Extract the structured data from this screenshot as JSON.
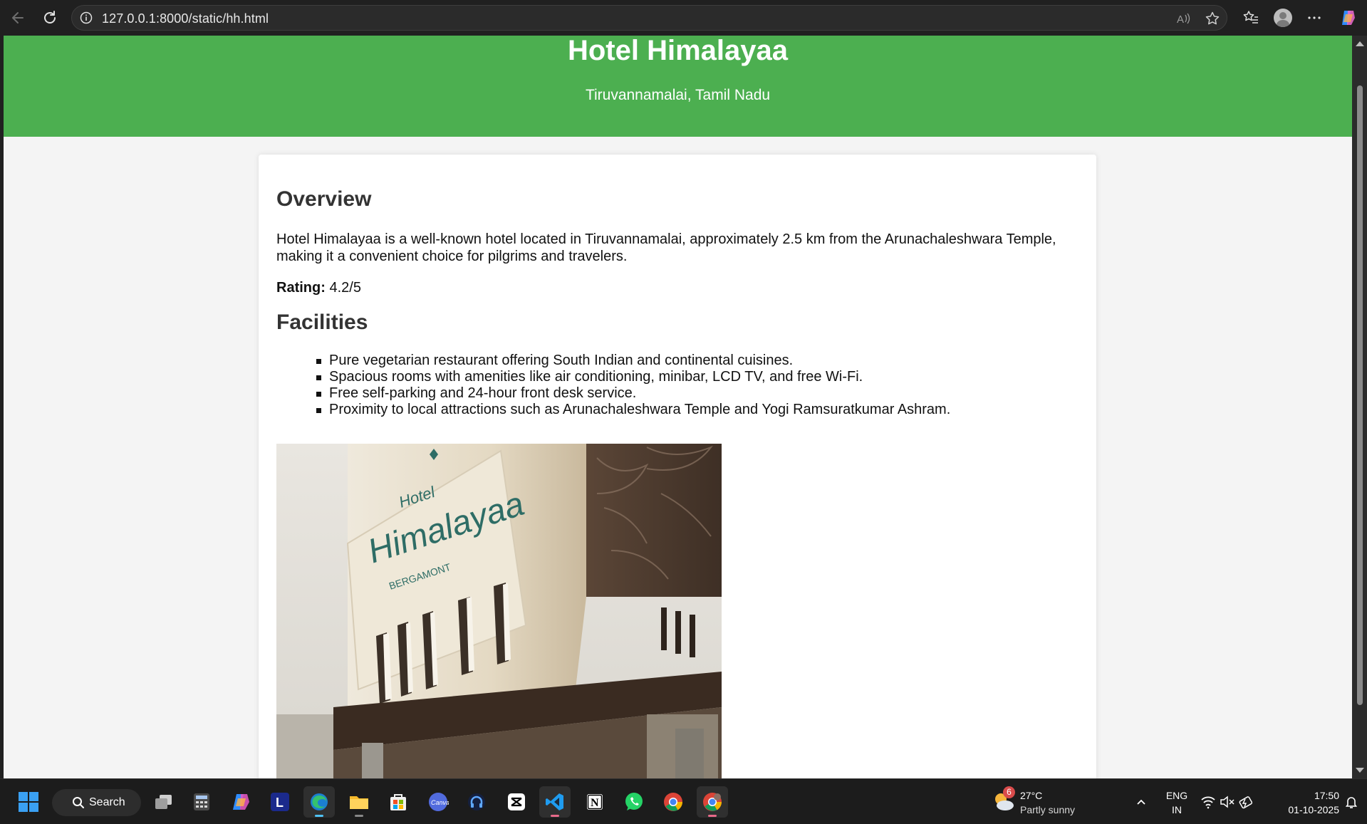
{
  "browser": {
    "url": "127.0.0.1:8000/static/hh.html"
  },
  "page": {
    "title": "Hotel Himalayaa",
    "subtitle": "Tiruvannamalai, Tamil Nadu",
    "overview_heading": "Overview",
    "overview_text": "Hotel Himalayaa is a well-known hotel located in Tiruvannamalai, approximately 2.5 km from the Arunachaleshwara Temple, making it a convenient choice for pilgrims and travelers.",
    "rating_label": "Rating:",
    "rating_value": "4.2/5",
    "facilities_heading": "Facilities",
    "facilities": [
      "Pure vegetarian restaurant offering South Indian and continental cuisines.",
      "Spacious rooms with amenities like air conditioning, minibar, LCD TV, and free Wi-Fi.",
      "Free self-parking and 24-hour front desk service.",
      "Proximity to local attractions such as Arunachaleshwara Temple and Yogi Ramsuratkumar Ashram."
    ],
    "photo_sign": {
      "line1": "Hotel",
      "line2": "Himalayaa",
      "line3": "BERGAMONT"
    }
  },
  "taskbar": {
    "search_label": "Search",
    "apps": [
      "task-view",
      "calculator",
      "copilot",
      "l-app",
      "edge",
      "file-explorer",
      "store",
      "canva",
      "headphones-app",
      "capcut",
      "vscode",
      "notion",
      "whatsapp",
      "chrome",
      "chrome-profile"
    ],
    "weather_badge": "6",
    "weather_temp": "27°C",
    "weather_desc": "Partly sunny",
    "lang_line1": "ENG",
    "lang_line2": "IN",
    "time": "17:50",
    "date": "01-10-2025"
  },
  "colors": {
    "header_green": "#4caf50",
    "page_bg": "#f4f4f4",
    "card_bg": "#ffffff"
  }
}
